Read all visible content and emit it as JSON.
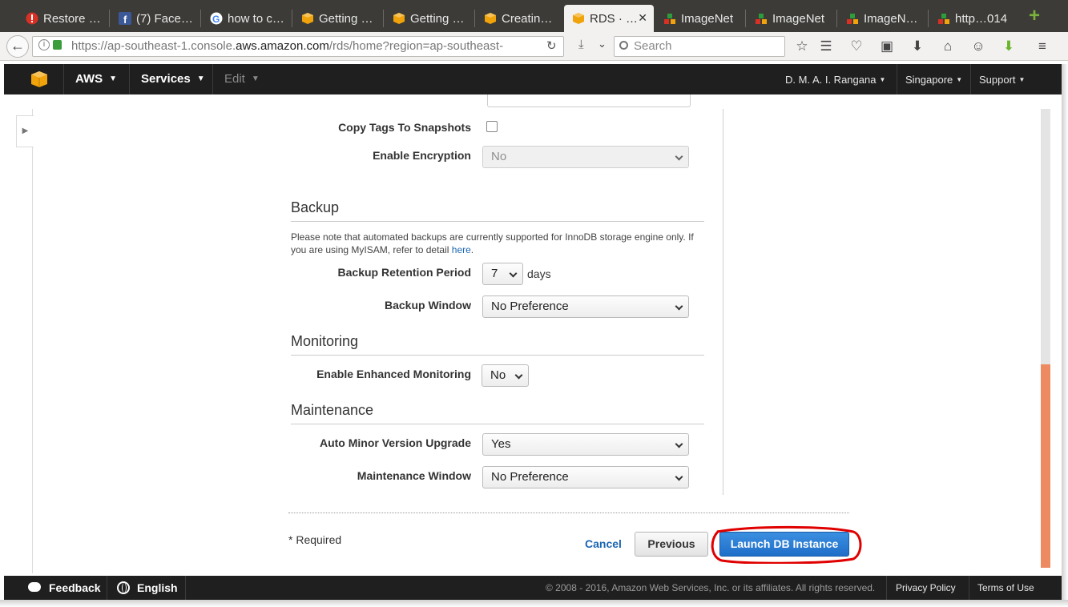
{
  "browser": {
    "tabs": [
      {
        "label": "Restore …",
        "icon": "error-icon"
      },
      {
        "label": "(7) Face…",
        "icon": "facebook-icon"
      },
      {
        "label": "how to c…",
        "icon": "google-icon"
      },
      {
        "label": "Getting …",
        "icon": "aws-box-icon"
      },
      {
        "label": "Getting …",
        "icon": "aws-box-icon"
      },
      {
        "label": "Creatin…",
        "icon": "aws-box-icon"
      },
      {
        "label": "RDS · …",
        "icon": "aws-box-icon",
        "active": true
      },
      {
        "label": "ImageNet",
        "icon": "imagenet-icon"
      },
      {
        "label": "ImageNet",
        "icon": "imagenet-icon"
      },
      {
        "label": "ImageN…",
        "icon": "imagenet-icon"
      },
      {
        "label": "http…014",
        "icon": "imagenet-icon"
      }
    ],
    "url_prefix": "https://ap-southeast-1.console.",
    "url_domain": "aws.amazon.com",
    "url_suffix": "/rds/home?region=ap-southeast-",
    "search_placeholder": "Search"
  },
  "aws_header": {
    "aws": "AWS",
    "services": "Services",
    "edit": "Edit",
    "user": "D. M. A. I. Rangana",
    "region": "Singapore",
    "support": "Support"
  },
  "form": {
    "copy_tags_label": "Copy Tags To Snapshots",
    "copy_tags_checked": false,
    "encryption_label": "Enable Encryption",
    "encryption_value": "No",
    "backup": {
      "title": "Backup",
      "note_text": "Please note that automated backups are currently supported for InnoDB storage engine only. If you are using MyISAM, refer to detail ",
      "note_link": "here",
      "note_end": ".",
      "retention_label": "Backup Retention Period",
      "retention_value": "7",
      "retention_unit": "days",
      "window_label": "Backup Window",
      "window_value": "No Preference"
    },
    "monitoring": {
      "title": "Monitoring",
      "enhanced_label": "Enable Enhanced Monitoring",
      "enhanced_value": "No"
    },
    "maintenance": {
      "title": "Maintenance",
      "minor_upgrade_label": "Auto Minor Version Upgrade",
      "minor_upgrade_value": "Yes",
      "window_label": "Maintenance Window",
      "window_value": "No Preference"
    },
    "required_note": "* Required",
    "cancel": "Cancel",
    "previous": "Previous",
    "launch": "Launch DB Instance"
  },
  "footer": {
    "feedback": "Feedback",
    "language": "English",
    "copyright": "© 2008 - 2016, Amazon Web Services, Inc. or its affiliates. All rights reserved.",
    "privacy": "Privacy Policy",
    "terms": "Terms of Use"
  },
  "colors": {
    "aws_header": "#1f1f1f",
    "primary_button": "#1f6ec9",
    "link": "#1a66b3",
    "scroll_thumb": "#ee8a62",
    "annotation": "#e00000"
  }
}
